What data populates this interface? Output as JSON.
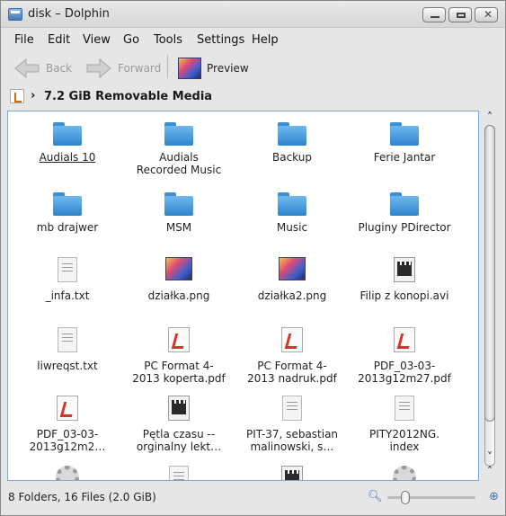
{
  "window": {
    "title": "disk – Dolphin",
    "buttons": [
      "minimize",
      "maximize",
      "close"
    ]
  },
  "menu": [
    "File",
    "Edit",
    "View",
    "Go",
    "Tools",
    "Settings",
    "Help"
  ],
  "toolbar": {
    "back": "Back",
    "forward": "Forward",
    "preview": "Preview"
  },
  "breadcrumb": {
    "location": "7.2 GiB Removable Media"
  },
  "files": {
    "r0": [
      "Audials 10",
      "Audials\nRecorded Music",
      "Backup",
      "Ferie Jantar"
    ],
    "r1": [
      "mb drajwer",
      "MSM",
      "Music",
      "Pluginy PDirector"
    ],
    "r2": [
      "_infa.txt",
      "działka.png",
      "działka2.png",
      "Filip z konopi.avi"
    ],
    "r3": [
      "liwreqst.txt",
      "PC Format 4-\n2013 koperta.pdf",
      "PC Format 4-\n2013 nadruk.pdf",
      "PDF_03-03-\n2013g12m27.pdf"
    ],
    "r4": [
      "PDF_03-03-\n2013g12m2…",
      "Pętla czasu --\norginalny lekt…",
      "PIT-37, sebastian\nmalinowski, s…",
      "PITY2012NG.\nindex"
    ]
  },
  "status": {
    "text": "8 Folders, 16 Files (2.0 GiB)",
    "zoom_level": 0.2
  }
}
